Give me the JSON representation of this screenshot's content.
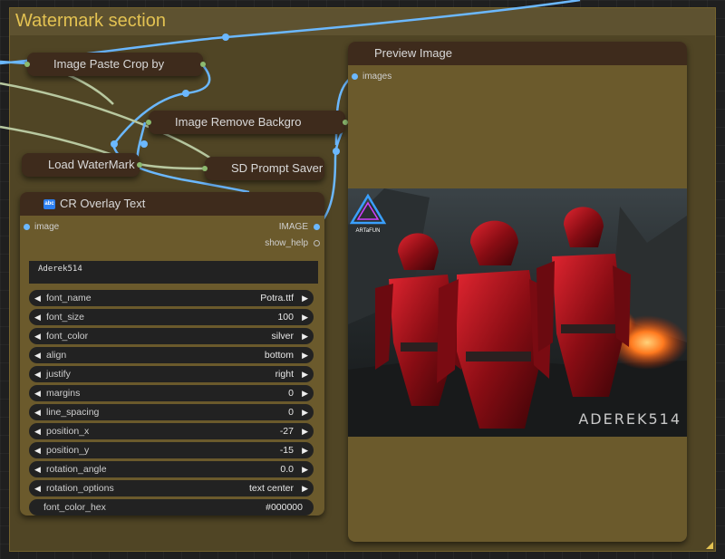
{
  "group": {
    "title": "Watermark section"
  },
  "nodes": {
    "paste_crop": {
      "title": "Image Paste Crop by"
    },
    "remove_bg": {
      "title": "Image Remove Backgro"
    },
    "load_watermark": {
      "title": "Load WaterMark"
    },
    "prompt_saver": {
      "title": "SD Prompt Saver"
    },
    "preview": {
      "title": "Preview Image",
      "input": "images"
    },
    "overlay": {
      "title": "CR Overlay Text",
      "badge": "abc",
      "input": "image",
      "outputs": [
        "IMAGE",
        "show_help"
      ],
      "text": "Aderek514",
      "widgets": [
        {
          "label": "font_name",
          "value": "Potra.ttf"
        },
        {
          "label": "font_size",
          "value": "100"
        },
        {
          "label": "font_color",
          "value": "silver"
        },
        {
          "label": "align",
          "value": "bottom"
        },
        {
          "label": "justify",
          "value": "right"
        },
        {
          "label": "margins",
          "value": "0"
        },
        {
          "label": "line_spacing",
          "value": "0"
        },
        {
          "label": "position_x",
          "value": "-27"
        },
        {
          "label": "position_y",
          "value": "-15"
        },
        {
          "label": "rotation_angle",
          "value": "0.0"
        },
        {
          "label": "rotation_options",
          "value": "text center"
        }
      ],
      "hex_widget": {
        "label": "font_color_hex",
        "value": "#000000"
      }
    }
  },
  "image": {
    "logo_text": "ARTaFUN",
    "watermark": "ADEREK514"
  },
  "colors": {
    "group_bg": "#504525",
    "group_title": "#e3c252",
    "wire_image": "#6bb8ff",
    "wire_other": "#b8c8a0",
    "node_title_bg": "#3e2b1c"
  }
}
